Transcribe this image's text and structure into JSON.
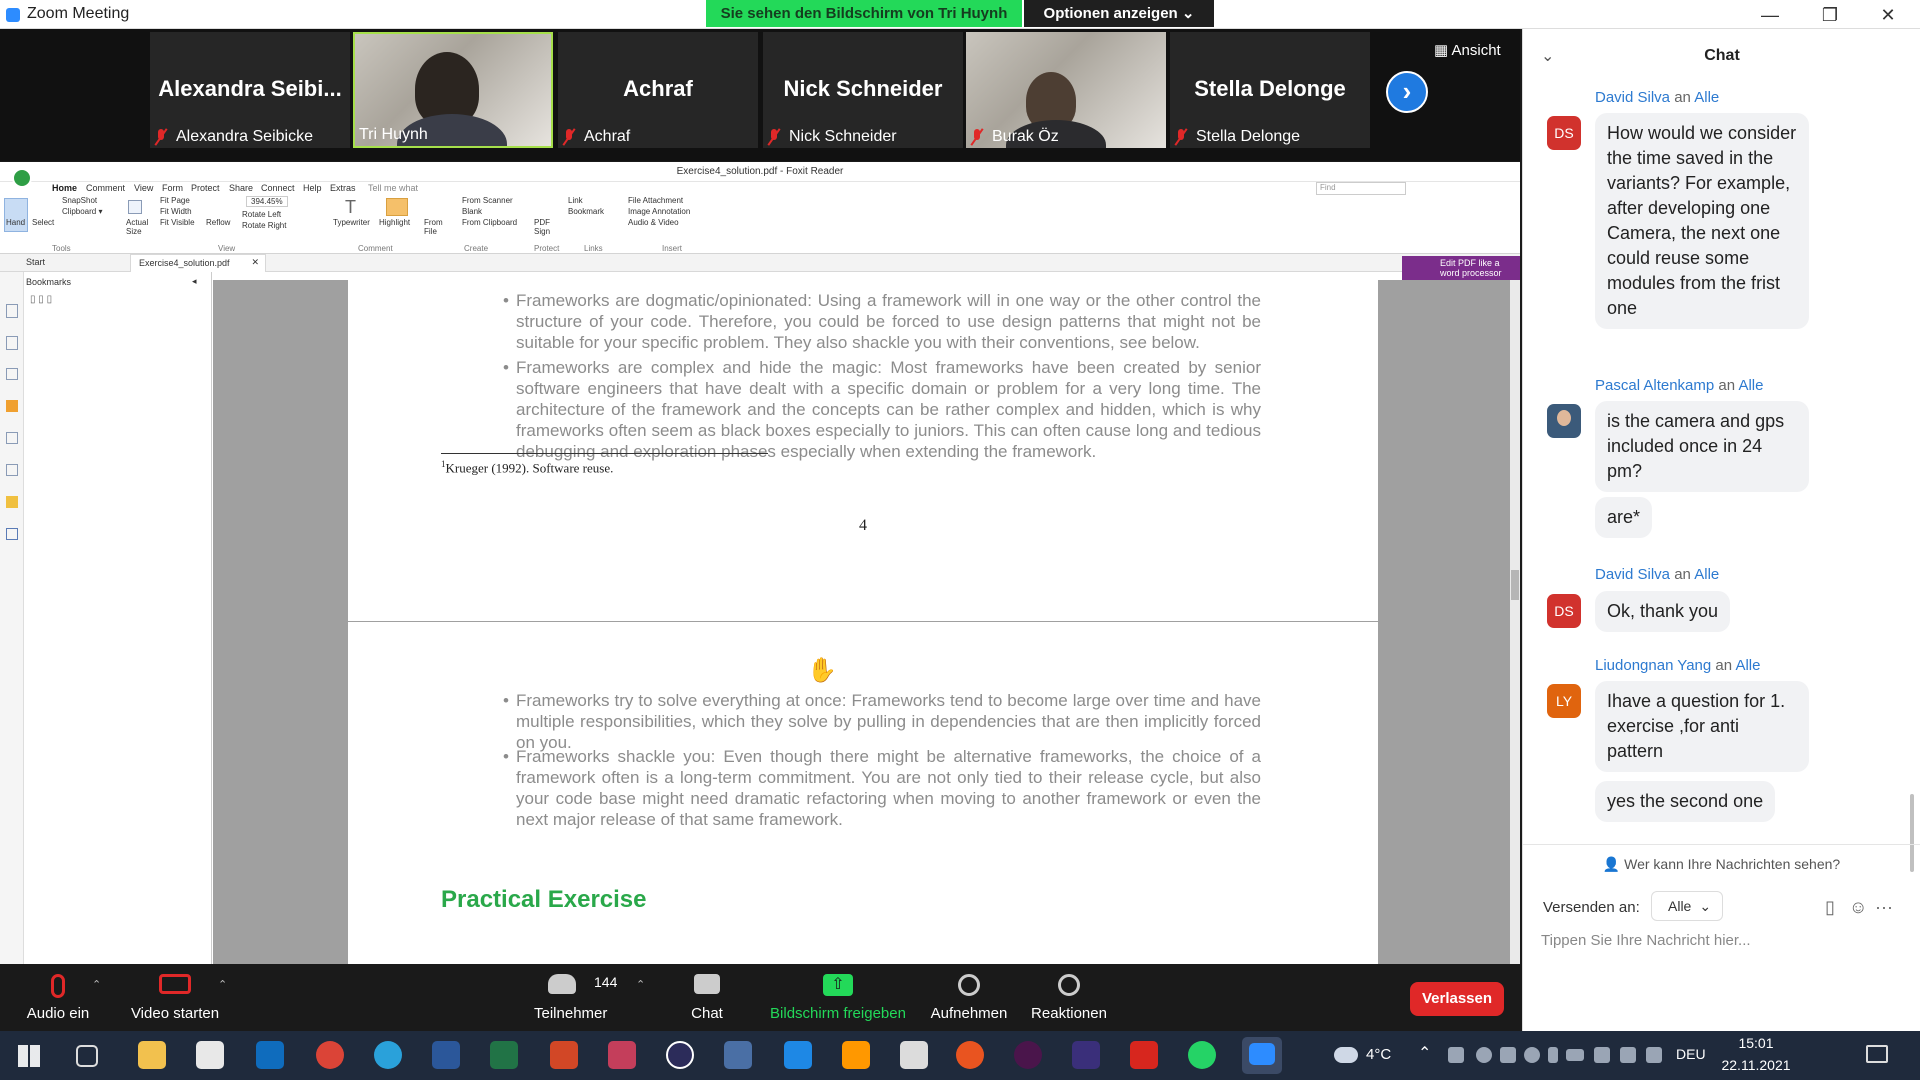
{
  "window": {
    "title": "Zoom Meeting",
    "minimize_glyph": "—",
    "restore_glyph": "❐",
    "close_glyph": "✕"
  },
  "share_banner": {
    "text": "Sie sehen den Bildschirm von Tri Huynh",
    "options_label": "Optionen anzeigen ⌄"
  },
  "gallery": {
    "view_label": "Ansicht",
    "participants": [
      {
        "display_name": "Alexandra  Seibi...",
        "label": "Alexandra Seibicke",
        "muted": true,
        "video": false
      },
      {
        "display_name": "",
        "label": "Tri Huynh",
        "muted": false,
        "video": true,
        "active_speaker": true
      },
      {
        "display_name": "Achraf",
        "label": "Achraf",
        "muted": true,
        "video": false
      },
      {
        "display_name": "Nick Schneider",
        "label": "Nick Schneider",
        "muted": true,
        "video": false
      },
      {
        "display_name": "",
        "label": "Burak Öz",
        "muted": true,
        "video": true
      },
      {
        "display_name": "Stella Delonge",
        "label": "Stella Delonge",
        "muted": true,
        "video": false
      }
    ]
  },
  "foxit": {
    "title": "Exercise4_solution.pdf - Foxit Reader",
    "search_placeholder": "Find",
    "menu": [
      "Home",
      "Comment",
      "View",
      "Form",
      "Protect",
      "Share",
      "Connect",
      "Help",
      "Extras",
      "Tell me what"
    ],
    "ribbon": {
      "hand": "Hand",
      "select": "Select",
      "snapshot": "SnapShot",
      "clipboard": "Clipboard ▾",
      "actual_size": "Actual Size",
      "fit_page": "Fit Page",
      "fit_width": "Fit Width",
      "fit_visible": "Fit Visible",
      "reflow": "Reflow",
      "zoom": "394.45%",
      "rotate_left": "Rotate Left",
      "rotate_right": "Rotate Right",
      "typewriter": "Typewriter",
      "highlight": "Highlight",
      "from_file": "From File",
      "from_scanner": "From Scanner",
      "blank": "Blank",
      "from_clipboard": "From Clipboard",
      "pdf_sign": "PDF Sign",
      "link": "Link",
      "bookmark": "Bookmark",
      "file_attachment": "File Attachment",
      "image_annotation": "Image Annotation",
      "audio_video": "Audio & Video",
      "groups": [
        "Tools",
        "View",
        "Comment",
        "Create",
        "Protect",
        "Links",
        "Insert"
      ]
    },
    "tabs": [
      "Start",
      "Exercise4_solution.pdf"
    ],
    "edit_pdf_label": "Edit PDF like a word processor",
    "bookmarks_title": "Bookmarks",
    "page_a": {
      "bullets": [
        "Frameworks are dogmatic/opinionated: Using a framework will in one way or the other control the structure of your code. Therefore, you could be forced to use design patterns that might not be suitable for your specific problem. They also shackle you with their conventions, see below.",
        "Frameworks are complex and hide the magic: Most frameworks have been created by senior software engineers that have dealt with a specific domain or problem for a very long time. The architecture of the framework and the concepts can be rather complex and hidden, which is why frameworks often seem as black boxes especially to juniors.  This can often cause long and tedious debugging and exploration phases especially when extending the framework."
      ],
      "footnote_mark": "1",
      "footnote": "Krueger (1992). Software reuse.",
      "page_number": "4"
    },
    "page_b": {
      "bullets": [
        "Frameworks try to solve everything at once: Frameworks tend to become large over time and have multiple responsibilities, which they solve by pulling in dependencies that are then implicitly forced on you.",
        "Frameworks shackle you: Even though there might be alternative frameworks, the choice of a framework often is a long-term commitment. You are not only tied to their release cycle, but also your code base might need dramatic refactoring when moving to another framework or even the next major release of that same framework."
      ],
      "heading": "Practical Exercise"
    }
  },
  "chat": {
    "title": "Chat",
    "to_word": "an",
    "messages": [
      {
        "sender": "David Silva",
        "to": "Alle",
        "initials": "DS",
        "avatar_color": "#d1322d",
        "text": "How would we consider the time saved in the variants? For example, after developing one Camera, the next one could reuse some modules from the frist one"
      },
      {
        "sender": "Pascal Altenkamp",
        "to": "Alle",
        "initials": "",
        "avatar_color": "#3b5a7a",
        "text": "is the camera and gps included once in 24 pm?",
        "followup": "are*"
      },
      {
        "sender": "David Silva",
        "to": "Alle",
        "initials": "DS",
        "avatar_color": "#d1322d",
        "text": "Ok, thank you"
      },
      {
        "sender": "Liudongnan Yang",
        "to": "Alle",
        "initials": "LY",
        "avatar_color": "#e0640e",
        "text": "Ihave a question for 1. exercise ,for anti pattern",
        "followup": "yes the second one"
      }
    ],
    "who_can_see": "Wer kann Ihre Nachrichten sehen?",
    "send_to_label": "Versenden an:",
    "send_to_value": "Alle",
    "input_placeholder": "Tippen Sie Ihre Nachricht hier..."
  },
  "toolbar": {
    "audio": "Audio ein",
    "video": "Video starten",
    "participants": "Teilnehmer",
    "participant_count": "144",
    "chat": "Chat",
    "share": "Bildschirm freigeben",
    "record": "Aufnehmen",
    "reactions": "Reaktionen",
    "leave": "Verlassen"
  },
  "taskbar": {
    "temperature": "4°C",
    "language": "DEU",
    "time": "15:01",
    "date": "22.11.2021"
  },
  "colors": {
    "zoom_blue": "#2d8cff",
    "share_green": "#23d959",
    "leave_red": "#e02828",
    "chat_link": "#2d7ad0",
    "heading_green": "#2aa84a"
  }
}
